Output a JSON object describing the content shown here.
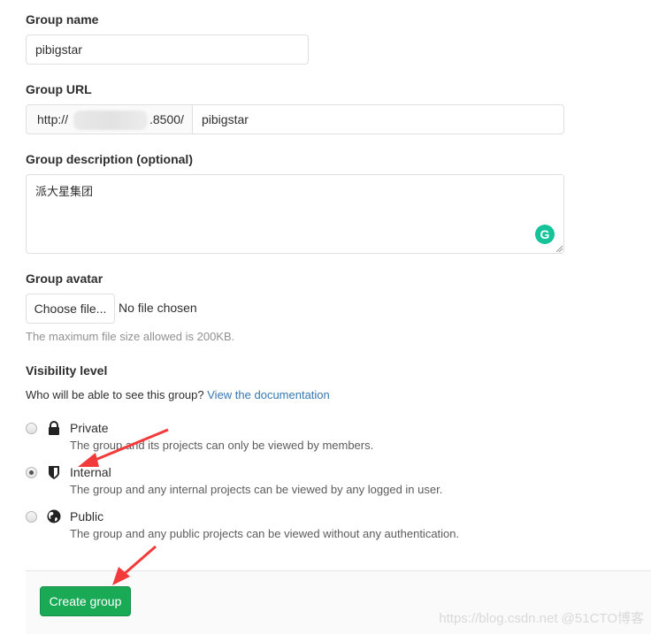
{
  "group_name": {
    "label": "Group name",
    "value": "pibigstar"
  },
  "group_url": {
    "label": "Group URL",
    "prefix_start": "http://",
    "prefix_end": ".8500/",
    "value": "pibigstar"
  },
  "group_description": {
    "label": "Group description (optional)",
    "value": "派大星集团",
    "grammarly_icon": "G"
  },
  "group_avatar": {
    "label": "Group avatar",
    "choose_button": "Choose file...",
    "file_status": "No file chosen",
    "help_text": "The maximum file size allowed is 200KB."
  },
  "visibility": {
    "label": "Visibility level",
    "question": "Who will be able to see this group?",
    "doc_link": "View the documentation",
    "selected": "Internal",
    "options": [
      {
        "title": "Private",
        "icon": "lock-icon",
        "description": "The group and its projects can only be viewed by members.",
        "checked": false
      },
      {
        "title": "Internal",
        "icon": "shield-icon",
        "description": "The group and any internal projects can be viewed by any logged in user.",
        "checked": true
      },
      {
        "title": "Public",
        "icon": "globe-icon",
        "description": "The group and any public projects can be viewed without any authentication.",
        "checked": false
      }
    ]
  },
  "footer": {
    "create_button": "Create group",
    "watermark": "https://blog.csdn.net @51CTO博客"
  },
  "colors": {
    "primary_green": "#1aaa55",
    "link_blue": "#3777b0",
    "annotation_red": "#f23a3a",
    "grammarly_green": "#15c39a"
  }
}
